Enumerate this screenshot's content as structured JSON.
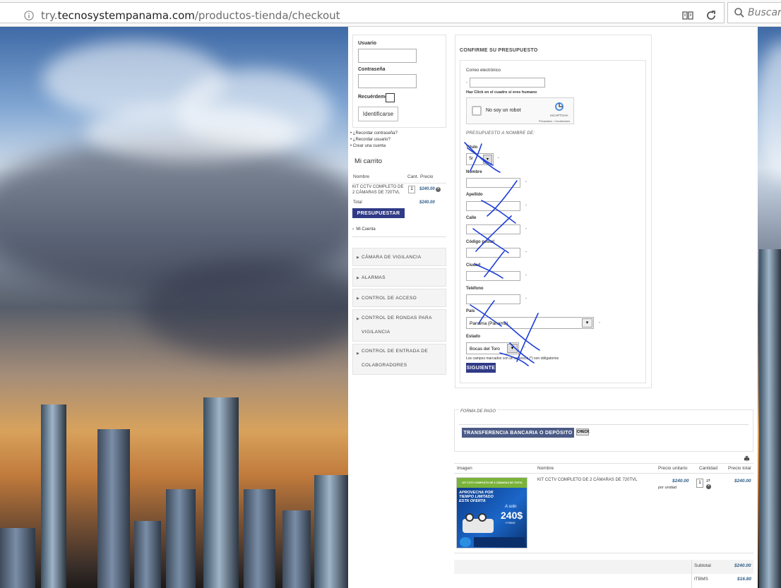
{
  "browser": {
    "url_prefix": "try.",
    "url_host": "tecnosystempanama.com",
    "url_path": "/productos-tienda/checkout",
    "search_placeholder": "Buscar"
  },
  "login": {
    "user_label": "Usuario",
    "password_label": "Contraseña",
    "remember_label": "Recuérdeme",
    "login_button": "Identificarse",
    "links": [
      "¿Recordar contraseña?",
      "¿Recordar usuario?",
      "Crear una cuenta"
    ]
  },
  "cart": {
    "title": "Mi carrito",
    "col_name": "Nombre",
    "col_qty": "Cant.",
    "col_price": "Precio",
    "item_name": "KIT CCTV COMPLETO DE 2 CÁMARAS DE 720TVL",
    "item_qty": "1",
    "item_price": "$240.00",
    "total_label": "Total",
    "total_value": "$240.00",
    "quote_button": "PRESUPUESTAR",
    "account_link": "Mi Cuenta"
  },
  "categories": [
    {
      "label": "CÁMARA DE VIGILANCIA"
    },
    {
      "label": "ALARMAS"
    },
    {
      "label": "CONTROL DE ACCESO"
    },
    {
      "label": "CONTROL DE RONDAS PARA VIGILANCIA"
    },
    {
      "label": "CONTROL DE ENTRADA DE COLABORADORES"
    }
  ],
  "confirm": {
    "title": "CONFIRME SU PRESUPUESTO",
    "email_label": "Correo electrónico",
    "captcha_hint": "Haz Click en el cuadro si eres humano",
    "captcha_label": "No soy un robot",
    "captcha_brand": "reCAPTCHA",
    "captcha_legal": "Privacidad - Condiciones",
    "section_title": "PRESUPUESTO A NOMBRE DE:",
    "title_label": "Título",
    "title_value": "Sr",
    "name_label": "Nombre",
    "lastname_label": "Apellido",
    "street_label": "Calle",
    "zip_label": "Código postal",
    "city_label": "Ciudad",
    "phone_label": "Teléfono",
    "country_label": "País",
    "country_value": "Panama (Panamá)",
    "state_label": "Estado",
    "state_value": "Bocas del Toro",
    "required_note": "Los campos marcados con un asterisco (*) son obligatorios",
    "next_button": "SIGUIENTE",
    "dash": "-"
  },
  "payment": {
    "title": "FORMA DE PAGO",
    "option_button": "TRANSFERENCIA BANCARIA O DEPÓSITO",
    "check_button": "CHECK"
  },
  "order_table": {
    "col_image": "Imagen",
    "col_name": "Nombre",
    "col_unit": "Precio unitario",
    "col_qty": "Cantidad",
    "col_total": "Precio total",
    "item_name": "KIT CCTV COMPLETO DE 2 CÁMARAS DE 720TVL",
    "unit_price": "$240.00",
    "unit_note": "por unidad",
    "qty": "1",
    "row_total": "$240.00",
    "subtotal_label": "Subtotal",
    "subtotal_value": "$240.00",
    "itbms_label": "ITBMS",
    "itbms_value": "$16.80"
  },
  "product_image": {
    "banner": "KIT CCTV COMPLETO DE 2 CÁMARAS DE 720TVL",
    "promo": "APROVECHA POR TIEMPO LIMITADO ESTA OFERTA",
    "price_prefix": "A solo",
    "price": "240$",
    "price_note": "+ITBMS"
  },
  "colors": {
    "primary_button": "#303a86",
    "payment_button": "#4b5b87",
    "price_text": "#2d5b86",
    "scribble": "#1f3fd6"
  }
}
